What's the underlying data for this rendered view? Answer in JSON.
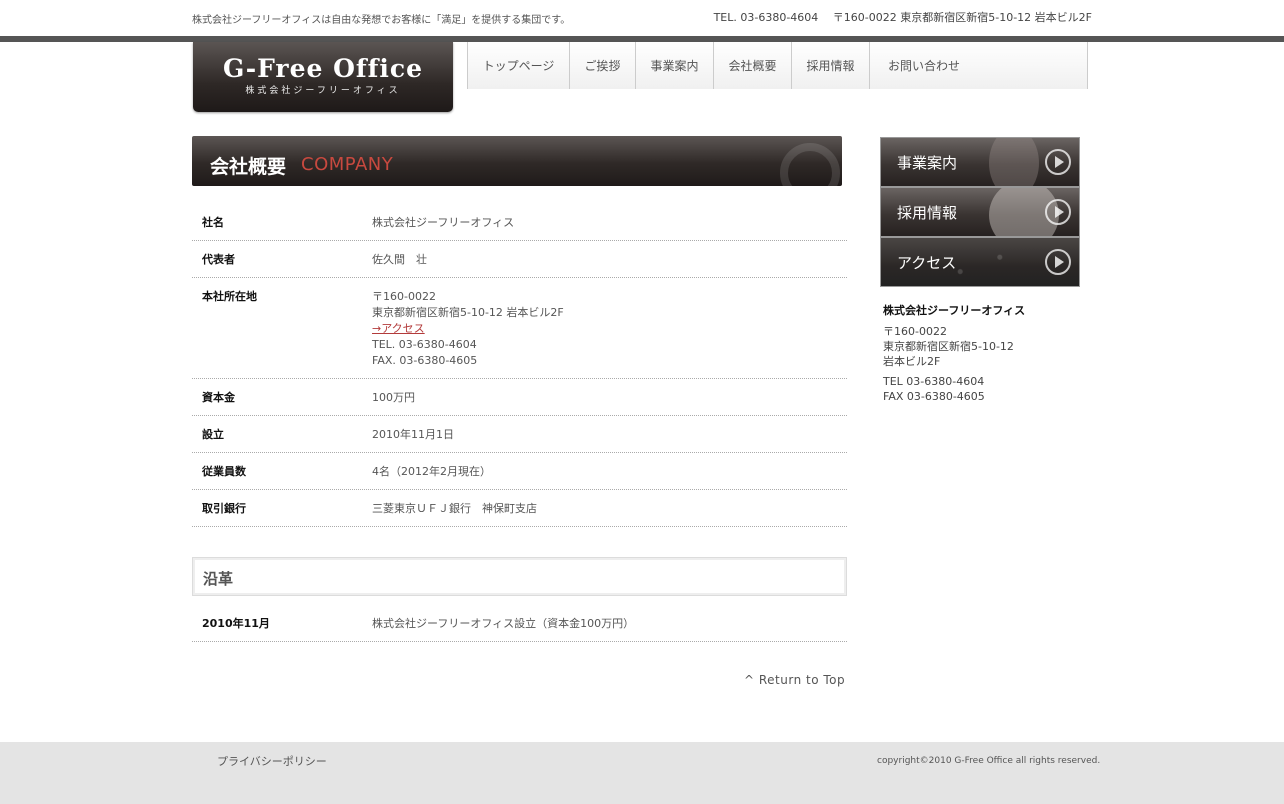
{
  "header": {
    "tagline": "株式会社ジーフリーオフィスは自由な発想でお客様に「満足」を提供する集団です。",
    "contact": "TEL. 03-6380-4604　 〒160-0022 東京都新宿区新宿5-10-12 岩本ビル2F",
    "logo_main": "G-Free Office",
    "logo_sub": "株式会社ジーフリーオフィス"
  },
  "nav": {
    "items": [
      "トップページ",
      "ご挨拶",
      "事業案内",
      "会社概要",
      "採用情報",
      "お問い合わせ"
    ]
  },
  "page_heading": {
    "jp": "会社概要",
    "en": "COMPANY"
  },
  "info": {
    "company_label": "社名",
    "company_value": "株式会社ジーフリーオフィス",
    "rep_label": "代表者",
    "rep_value": "佐久間　壮",
    "address_label": "本社所在地",
    "address_postal": "〒160-0022",
    "address_line": "東京都新宿区新宿5-10-12 岩本ビル2F",
    "access_link": "→アクセス",
    "address_tel": "TEL. 03-6380-4604",
    "address_fax": "FAX. 03-6380-4605",
    "capital_label": "資本金",
    "capital_value": "100万円",
    "founded_label": "設立",
    "founded_value": "2010年11月1日",
    "employees_label": "従業員数",
    "employees_value": "4名（2012年2月現在）",
    "bank_label": "取引銀行",
    "bank_value": "三菱東京ＵＦＪ銀行　神保町支店"
  },
  "history": {
    "title": "沿革",
    "entries": [
      {
        "date": "2010年11月",
        "event": "株式会社ジーフリーオフィス設立（資本金100万円）"
      }
    ]
  },
  "return_top": "^ Return to Top",
  "sidebar": {
    "banners": [
      "事業案内",
      "採用情報",
      "アクセス"
    ],
    "company_name": "株式会社ジーフリーオフィス",
    "postal": "〒160-0022",
    "address1": "東京都新宿区新宿5-10-12",
    "address2": "岩本ビル2F",
    "tel": "TEL 03-6380-4604",
    "fax": "FAX 03-6380-4605"
  },
  "footer": {
    "privacy": "プライバシーポリシー",
    "copyright": "copyright©2010 G-Free Office all rights reserved."
  }
}
